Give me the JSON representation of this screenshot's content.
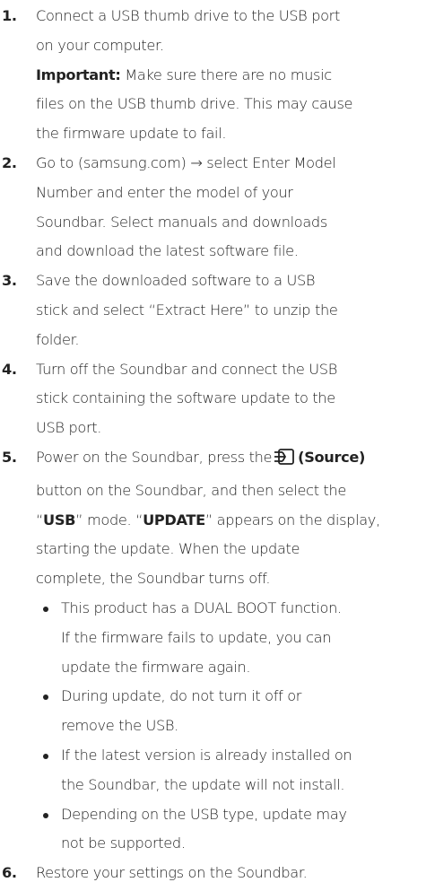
{
  "steps": [
    {
      "number": "1.",
      "lines": [
        "Connect a USB thumb drive to the USB port",
        "on your computer."
      ],
      "note_label": "Important:",
      "note_lines": [
        "Make sure there are no music",
        "files on the USB thumb drive. This may cause",
        "the firmware update to fail."
      ]
    },
    {
      "number": "2.",
      "lines": [
        "Go to (samsung.com) → select Enter Model",
        "Number and enter the model of your",
        "Soundbar. Select manuals and downloads",
        "and download the latest software file."
      ]
    },
    {
      "number": "3.",
      "lines": [
        "Save the downloaded software to a USB",
        "stick and select “Extract Here” to unzip the",
        "folder."
      ]
    },
    {
      "number": "4.",
      "lines": [
        "Turn off the Soundbar and connect the USB",
        "stick containing the software update to the",
        "USB port."
      ]
    },
    {
      "number": "5.",
      "l1_pre": "Power on the Soundbar, press the",
      "l1_bold": "(Source)",
      "l2": "button on the Soundbar, and then select the",
      "l3_q1": "“",
      "l3_b1": "USB",
      "l3_q2": "” mode. “",
      "l3_b2": "UPDATE",
      "l3_rest": "” appears on the display,",
      "l4": "starting the update. When the update",
      "l5": "complete, the Soundbar turns off.",
      "bullets": [
        {
          "lines": [
            "This product has a DUAL BOOT function.",
            "If the firmware fails to update, you can",
            "update the firmware again."
          ]
        },
        {
          "lines": [
            "During update, do not turn it off or",
            "remove the USB."
          ]
        },
        {
          "lines": [
            "If the latest version is already installed on",
            "the Soundbar, the update will not install."
          ]
        },
        {
          "lines": [
            "Depending on the USB type, update may",
            "not be supported."
          ]
        }
      ]
    },
    {
      "number": "6.",
      "lines": [
        "Restore your settings on the Soundbar."
      ]
    }
  ],
  "icons": {
    "source": "source-icon"
  }
}
